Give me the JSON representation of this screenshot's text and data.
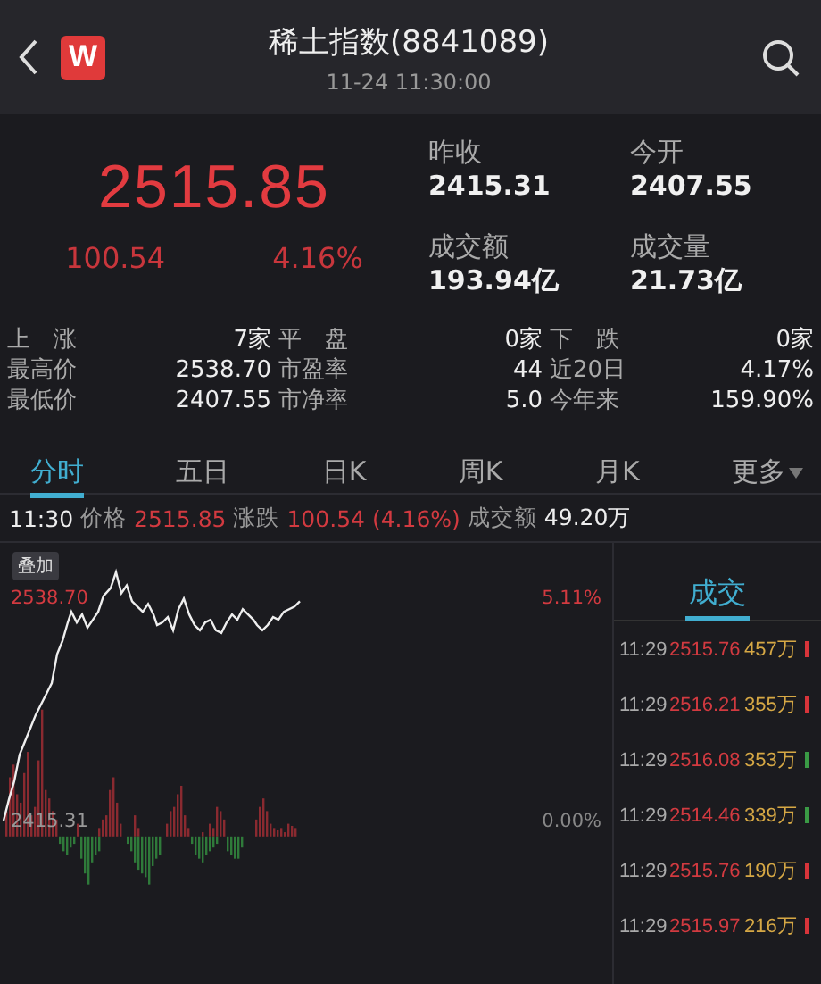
{
  "header": {
    "title": "稀土指数(8841089)",
    "time": "11-24 11:30:00",
    "logo": "W"
  },
  "quote": {
    "price": "2515.85",
    "change": "100.54",
    "change_pct": "4.16%"
  },
  "summary": [
    {
      "label": "昨收",
      "value": "2415.31"
    },
    {
      "label": "今开",
      "value": "2407.55"
    },
    {
      "label": "成交额",
      "value": "193.94亿"
    },
    {
      "label": "成交量",
      "value": "21.73亿"
    }
  ],
  "stats": [
    {
      "label": "上　涨",
      "value": "7家"
    },
    {
      "label": "平　盘",
      "value": "0家"
    },
    {
      "label": "下　跌",
      "value": "0家"
    },
    {
      "label": "最高价",
      "value": "2538.70"
    },
    {
      "label": "市盈率",
      "value": "44"
    },
    {
      "label": "近20日",
      "value": "4.17%"
    },
    {
      "label": "最低价",
      "value": "2407.55"
    },
    {
      "label": "市净率",
      "value": "5.0"
    },
    {
      "label": "今年来",
      "value": "159.90%"
    }
  ],
  "tabs": [
    {
      "label": "分时",
      "selected": true
    },
    {
      "label": "五日",
      "selected": false
    },
    {
      "label": "日K",
      "selected": false
    },
    {
      "label": "周K",
      "selected": false
    },
    {
      "label": "月K",
      "selected": false
    },
    {
      "label": "更多",
      "selected": false,
      "dropdown": true
    }
  ],
  "info_line": {
    "time": "11:30",
    "price_label": "价格",
    "price": "2515.85",
    "change_label": "涨跌",
    "change": "100.54 (4.16%)",
    "amount_label": "成交额",
    "amount": "49.20万"
  },
  "chart": {
    "overlay_button": "叠加",
    "high_label": "2538.70",
    "base_label": "2415.31",
    "high_pct": "5.11%",
    "base_pct": "0.00%"
  },
  "trades_title": "成交",
  "trades": [
    {
      "time": "11:29",
      "price": "2515.76",
      "volume": "457万",
      "color": "#d8343a"
    },
    {
      "time": "11:29",
      "price": "2516.21",
      "volume": "355万",
      "color": "#d8343a"
    },
    {
      "time": "11:29",
      "price": "2516.08",
      "volume": "353万",
      "color": "#3a9a45"
    },
    {
      "time": "11:29",
      "price": "2514.46",
      "volume": "339万",
      "color": "#3a9a45"
    },
    {
      "time": "11:29",
      "price": "2515.76",
      "volume": "190万",
      "color": "#d8343a"
    },
    {
      "time": "11:29",
      "price": "2515.97",
      "volume": "216万",
      "color": "#d8343a"
    }
  ]
}
